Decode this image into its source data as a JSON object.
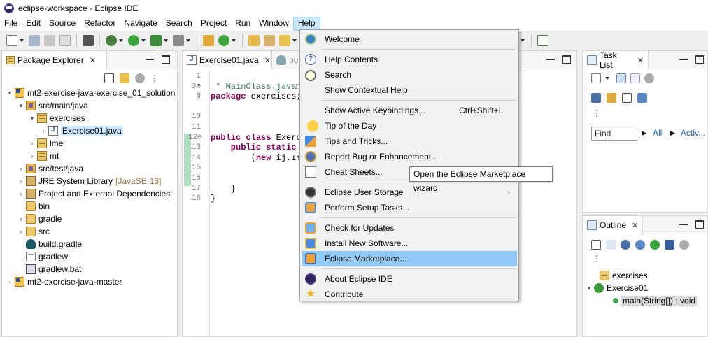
{
  "window": {
    "title": "eclipse-workspace - Eclipse IDE"
  },
  "menubar": {
    "items": [
      "File",
      "Edit",
      "Source",
      "Refactor",
      "Navigate",
      "Search",
      "Project",
      "Run",
      "Window",
      "Help"
    ],
    "active": "Help"
  },
  "package_explorer": {
    "tab_label": "Package Explorer",
    "close": "✕",
    "tree": [
      {
        "label": "mt2-exercise-java-exercise_01_solution",
        "icon": "project-icon",
        "twisty": "expanded"
      },
      {
        "label": "src/main/java",
        "icon": "source-folder-icon",
        "twisty": "expanded"
      },
      {
        "label": "exercises",
        "icon": "package-icon",
        "twisty": "expanded"
      },
      {
        "label": "Exercise01.java",
        "icon": "java-file-icon",
        "twisty": "collapsed",
        "selected": true
      },
      {
        "label": "lme",
        "icon": "package-icon",
        "twisty": "collapsed"
      },
      {
        "label": "mt",
        "icon": "package-icon",
        "twisty": "collapsed"
      },
      {
        "label": "src/test/java",
        "icon": "source-folder-icon",
        "twisty": "collapsed"
      },
      {
        "label": "JRE System Library",
        "suffix": "[JavaSE-13]",
        "icon": "library-icon",
        "twisty": "collapsed"
      },
      {
        "label": "Project and External Dependencies",
        "icon": "library-icon",
        "twisty": "collapsed"
      },
      {
        "label": "bin",
        "icon": "folder-icon",
        "twisty": "none"
      },
      {
        "label": "gradle",
        "icon": "folder-icon",
        "twisty": "collapsed"
      },
      {
        "label": "src",
        "icon": "folder-icon",
        "twisty": "collapsed"
      },
      {
        "label": "build.gradle",
        "icon": "gradle-icon",
        "twisty": "none"
      },
      {
        "label": "gradlew",
        "icon": "file-icon",
        "twisty": "none"
      },
      {
        "label": "gradlew.bat",
        "icon": "bat-file-icon",
        "twisty": "none"
      },
      {
        "label": "mt2-exercise-java-master",
        "icon": "project-icon",
        "twisty": "collapsed"
      }
    ]
  },
  "editor": {
    "tab_label": "Exercise01.java",
    "close": "✕",
    "second_tab_label": "bui",
    "line_numbers": [
      "1",
      "3⊕",
      "8",
      "10",
      "11",
      "12⊖",
      "13",
      "14",
      "15",
      "16",
      "17",
      "18"
    ],
    "lines": [
      {
        "parts": []
      },
      {
        "parts": [
          {
            "t": " * MainClass.java",
            "c": "cm"
          },
          {
            "t": "⬚",
            "c": ""
          }
        ]
      },
      {
        "parts": [
          {
            "t": "package",
            "c": "kw"
          },
          {
            "t": " exercises;",
            "c": ""
          }
        ]
      },
      {
        "parts": []
      },
      {
        "parts": []
      },
      {
        "parts": [
          {
            "t": "public",
            "c": "kw"
          },
          {
            "t": " ",
            "c": ""
          },
          {
            "t": "class",
            "c": "kw"
          },
          {
            "t": " Exerci",
            "c": ""
          }
        ]
      },
      {
        "parts": [
          {
            "t": "    public",
            "c": "kw"
          },
          {
            "t": " ",
            "c": ""
          },
          {
            "t": "static",
            "c": "kw"
          },
          {
            "t": " v",
            "c": "kw"
          }
        ]
      },
      {
        "parts": [
          {
            "t": "        (",
            "c": ""
          },
          {
            "t": "new",
            "c": "kw"
          },
          {
            "t": " ij.Ima",
            "c": ""
          }
        ]
      },
      {
        "parts": []
      },
      {
        "parts": []
      },
      {
        "parts": [
          {
            "t": "    }",
            "c": ""
          }
        ]
      },
      {
        "parts": [
          {
            "t": "}",
            "c": ""
          }
        ]
      },
      {
        "parts": []
      }
    ]
  },
  "help_menu": {
    "items": [
      {
        "label": "Welcome",
        "icon": "welcome-icon"
      },
      {
        "sep": true
      },
      {
        "label": "Help Contents",
        "icon": "help-contents-icon"
      },
      {
        "label": "Search",
        "icon": "search-help-icon"
      },
      {
        "label": "Show Contextual Help",
        "icon": ""
      },
      {
        "sep": true
      },
      {
        "label": "Show Active Keybindings...",
        "shortcut": "Ctrl+Shift+L",
        "icon": ""
      },
      {
        "label": "Tip of the Day",
        "icon": "lightbulb-icon"
      },
      {
        "label": "Tips and Tricks...",
        "icon": "tips-tricks-icon"
      },
      {
        "label": "Report Bug or Enhancement...",
        "icon": "bug-report-icon"
      },
      {
        "label": "Cheat Sheets...",
        "icon": "cheat-sheet-icon"
      },
      {
        "sep": true
      },
      {
        "label": "Eclipse User Storage",
        "icon": "user-storage-icon",
        "submenu": "›"
      },
      {
        "label": "Perform Setup Tasks...",
        "icon": "setup-tasks-icon"
      },
      {
        "sep": true
      },
      {
        "label": "Check for Updates",
        "icon": "check-updates-icon"
      },
      {
        "label": "Install New Software...",
        "icon": "install-software-icon"
      },
      {
        "label": "Eclipse Marketplace...",
        "icon": "marketplace-icon",
        "highlighted": true
      },
      {
        "sep": true
      },
      {
        "label": "About Eclipse IDE",
        "icon": "about-eclipse-icon"
      },
      {
        "label": "Contribute",
        "icon": "star-icon"
      }
    ]
  },
  "tooltip": {
    "text": "Open the Eclipse Marketplace wizard"
  },
  "task_list": {
    "tab_label": "Task List",
    "close": "✕",
    "find_placeholder": "Find",
    "all_label": "All",
    "activate_label": "Activ..."
  },
  "outline": {
    "tab_label": "Outline",
    "close": "✕",
    "items": [
      {
        "label": "exercises",
        "icon": "package-icon"
      },
      {
        "label": "Exercise01",
        "icon": "class-icon",
        "twisty": "expanded"
      },
      {
        "label": "main(String[]) : void",
        "icon": "method-icon",
        "selected": true
      }
    ]
  }
}
